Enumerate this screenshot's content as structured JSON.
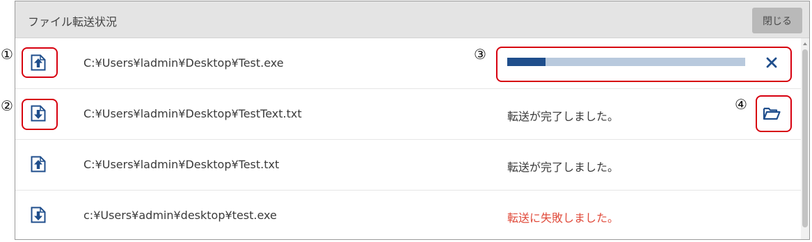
{
  "dialog": {
    "title": "ファイル転送状況",
    "close_label": "閉じる"
  },
  "transfers": [
    {
      "direction": "upload",
      "icon": "upload-arrow-icon",
      "path": "C:¥Users¥ladmin¥Desktop¥Test.exe",
      "state": "in-progress",
      "progress_percent": 16
    },
    {
      "direction": "download",
      "icon": "download-arrow-icon",
      "path": "C:¥Users¥ladmin¥Desktop¥TestText.txt",
      "state": "completed",
      "status_text": "転送が完了しました。",
      "action_icon": "open-folder-icon"
    },
    {
      "direction": "upload",
      "icon": "upload-arrow-icon",
      "path": "C:¥Users¥ladmin¥Desktop¥Test.txt",
      "state": "completed",
      "status_text": "転送が完了しました。"
    },
    {
      "direction": "download",
      "icon": "download-arrow-icon",
      "path": "c:¥Users¥admin¥desktop¥test.exe",
      "state": "failed",
      "status_text": "転送に失敗しました。"
    }
  ],
  "annotations": [
    "①",
    "②",
    "③",
    "④"
  ],
  "colors": {
    "accent": "#1f4e8c",
    "progress_track": "#b8c9dd",
    "error": "#e04a3a",
    "annotation": "#d7000f",
    "header_bg": "#e4e4e4",
    "close_button_bg": "#b9b9b9"
  }
}
